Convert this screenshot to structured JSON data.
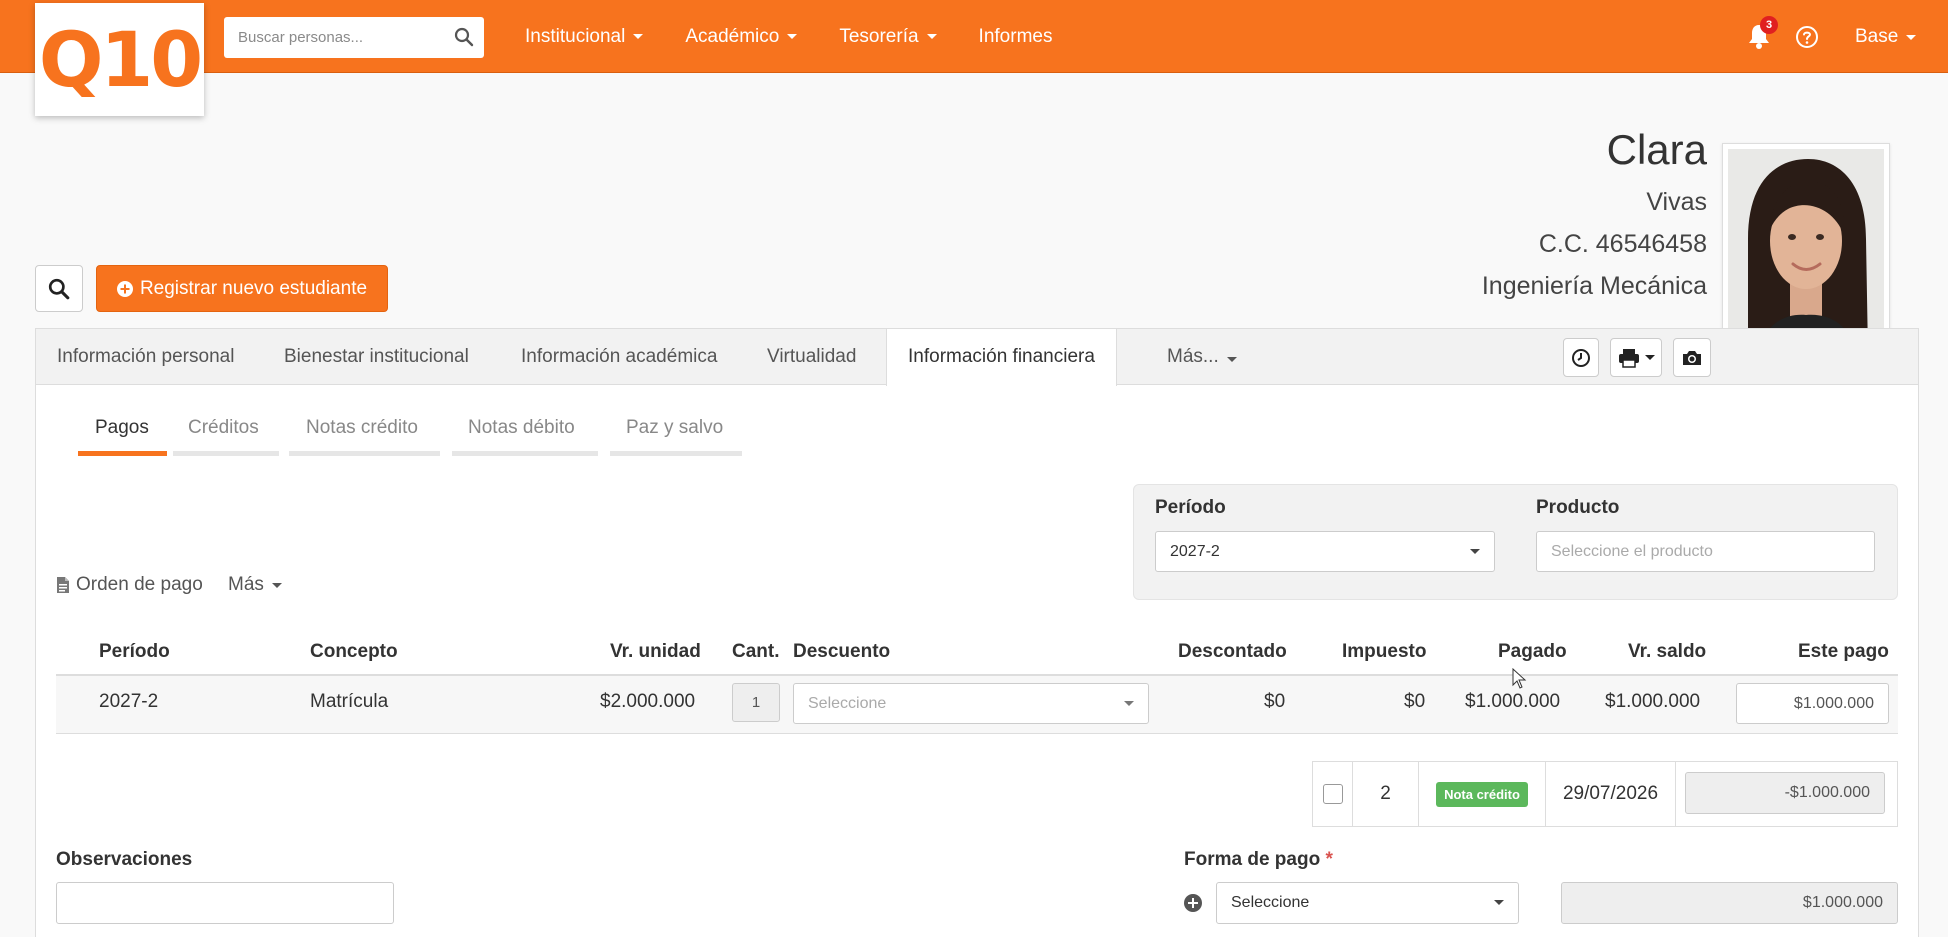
{
  "header": {
    "logo": "Q10",
    "search_placeholder": "Buscar personas...",
    "nav": [
      "Institucional",
      "Académico",
      "Tesorería",
      "Informes"
    ],
    "notifications_count": "3",
    "user_menu": "Base"
  },
  "profile": {
    "first_name": "Clara",
    "last_name": "Vivas",
    "id": "C.C. 46546458",
    "program": "Ingeniería Mecánica"
  },
  "actions": {
    "register_label": "Registrar nuevo estudiante"
  },
  "tabs": {
    "personal": "Información personal",
    "bienestar": "Bienestar institucional",
    "academica": "Información académica",
    "virtualidad": "Virtualidad",
    "financiera": "Información financiera",
    "mas": "Más..."
  },
  "subtabs": {
    "pagos": "Pagos",
    "creditos": "Créditos",
    "notas_credito": "Notas crédito",
    "notas_debito": "Notas débito",
    "paz_salvo": "Paz y salvo"
  },
  "filters": {
    "periodo_label": "Período",
    "periodo_value": "2027-2",
    "producto_label": "Producto",
    "producto_placeholder": "Seleccione el producto"
  },
  "links": {
    "orden_pago": "Orden de pago",
    "mas": "Más"
  },
  "table": {
    "headers": {
      "periodo": "Período",
      "concepto": "Concepto",
      "vr_unidad": "Vr. unidad",
      "cant": "Cant.",
      "descuento": "Descuento",
      "descontado": "Descontado",
      "impuesto": "Impuesto",
      "pagado": "Pagado",
      "vr_saldo": "Vr. saldo",
      "este_pago": "Este pago"
    },
    "row": {
      "periodo": "2027-2",
      "concepto": "Matrícula",
      "vr_unidad": "$2.000.000",
      "cant": "1",
      "descuento": "Seleccione",
      "descontado": "$0",
      "impuesto": "$0",
      "pagado": "$1.000.000",
      "vr_saldo": "$1.000.000",
      "este_pago": "$1.000.000"
    }
  },
  "nota_credito": {
    "number": "2",
    "badge": "Nota crédito",
    "date": "29/07/2026",
    "amount": "-$1.000.000"
  },
  "footer": {
    "observaciones_label": "Observaciones",
    "forma_pago_label": "Forma de pago",
    "required_mark": "*",
    "forma_pago_value": "Seleccione",
    "forma_pago_amount": "$1.000.000"
  },
  "colors": {
    "brand": "#f7731e",
    "success": "#5cb85c"
  }
}
